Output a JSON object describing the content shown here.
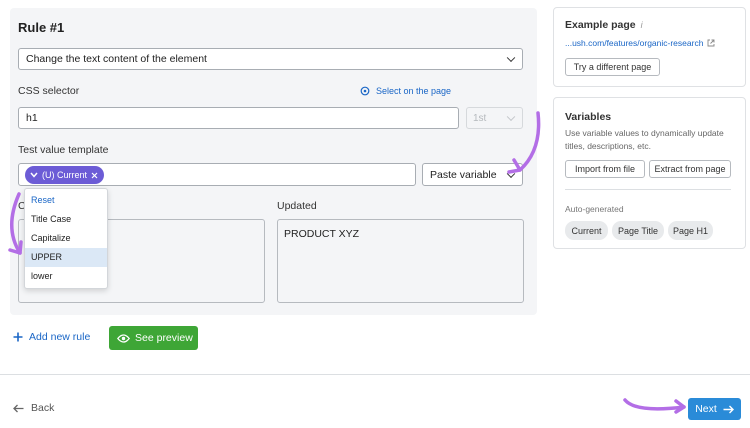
{
  "rule": {
    "title": "Rule #1",
    "action_select": "Change the text content of the element",
    "css_selector_label": "CSS selector",
    "select_on_page": "Select on the page",
    "css_selector_value": "h1",
    "occurrence_select": "1st",
    "template_label": "Test value template",
    "chip_label": "(U) Current",
    "paste_variable": "Paste variable",
    "dropdown_items": [
      "Reset",
      "Title Case",
      "Capitalize",
      "UPPER",
      "lower"
    ],
    "current_label_fragment": "C",
    "updated_label": "Updated",
    "updated_value": "PRODUCT XYZ"
  },
  "actions": {
    "add_rule": "Add new rule",
    "see_preview": "See preview"
  },
  "example_page": {
    "title": "Example page",
    "url": "...ush.com/features/organic-research",
    "try_button": "Try a different page"
  },
  "variables": {
    "title": "Variables",
    "description": "Use variable values to dynamically update titles, descriptions, etc.",
    "import_button": "Import from file",
    "extract_button": "Extract from page",
    "auto_label": "Auto-generated",
    "pills": [
      "Current",
      "Page Title",
      "Page H1"
    ]
  },
  "footer": {
    "back": "Back",
    "next": "Next"
  },
  "colors": {
    "accent": "#1a66c6",
    "chip": "#6c5cd6",
    "preview": "#3ea636",
    "next": "#2a8bd8",
    "arrow": "#b36ee6"
  }
}
